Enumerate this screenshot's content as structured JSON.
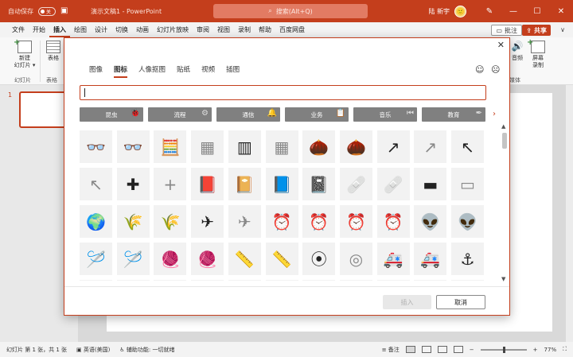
{
  "app": {
    "autosave_label": "自动保存",
    "autosave_state": "关",
    "doc_title": "演示文稿1 - PowerPoint",
    "search_placeholder": "搜索(Alt+Q)",
    "user_name": "陆 新宇",
    "user_avatar_text": "🙂"
  },
  "menu": {
    "items": [
      "文件",
      "开始",
      "插入",
      "绘图",
      "设计",
      "切换",
      "动画",
      "幻灯片放映",
      "审阅",
      "视图",
      "录制",
      "帮助",
      "百度网盘"
    ],
    "active_index": 2,
    "comment_label": "批注",
    "share_label": "共享"
  },
  "ribbon": {
    "new_slide_label": "新建\n幻灯片",
    "new_slide_line1": "新建",
    "new_slide_line2": "幻灯片 ▾",
    "table_label": "表格",
    "slides_group": "幻灯片",
    "tables_group": "表格",
    "audio_label": "音频",
    "screen_rec_line1": "屏幕",
    "screen_rec_line2": "录制",
    "media_group": "媒体"
  },
  "thumbnails": {
    "slide_number": "1"
  },
  "dialog": {
    "tabs": [
      "图像",
      "图标",
      "人像抠图",
      "贴纸",
      "视频",
      "插图"
    ],
    "active_tab_index": 1,
    "search_value": "",
    "categories": [
      {
        "label": "昆虫",
        "icon": "🐞"
      },
      {
        "label": "流程",
        "icon": "⚙"
      },
      {
        "label": "通信",
        "icon": "🔔"
      },
      {
        "label": "业务",
        "icon": "📋"
      },
      {
        "label": "音乐",
        "icon": "⏮"
      },
      {
        "label": "教育",
        "icon": "✒"
      }
    ],
    "icons": [
      {
        "name": "3d-glasses-filled-icon",
        "glyph": "👓",
        "light": false
      },
      {
        "name": "3d-glasses-outline-icon",
        "glyph": "👓",
        "light": true
      },
      {
        "name": "abacus-filled-icon",
        "glyph": "🧮",
        "light": false
      },
      {
        "name": "abacus-outline-icon",
        "glyph": "▦",
        "light": true
      },
      {
        "name": "abacus-frame-filled-icon",
        "glyph": "▥",
        "light": false
      },
      {
        "name": "abacus-frame-outline-icon",
        "glyph": "▦",
        "light": true
      },
      {
        "name": "acorn-filled-icon",
        "glyph": "🌰",
        "light": false
      },
      {
        "name": "acorn-outline-icon",
        "glyph": "🌰",
        "light": true
      },
      {
        "name": "arrow-curve-right-filled-icon",
        "glyph": "↗",
        "light": false
      },
      {
        "name": "arrow-curve-right-outline-icon",
        "glyph": "↗",
        "light": true
      },
      {
        "name": "arrow-curve-left-filled-icon",
        "glyph": "↖",
        "light": false
      },
      {
        "name": "arrow-curve-left-outline-icon",
        "glyph": "↖",
        "light": true
      },
      {
        "name": "plus-filled-icon",
        "glyph": "✚",
        "light": false
      },
      {
        "name": "plus-outline-icon",
        "glyph": "+",
        "light": true
      },
      {
        "name": "address-book-filled-icon",
        "glyph": "📕",
        "light": false
      },
      {
        "name": "address-book-outline-icon",
        "glyph": "📔",
        "light": true
      },
      {
        "name": "contact-book-filled-icon",
        "glyph": "📘",
        "light": false
      },
      {
        "name": "contact-book-outline-icon",
        "glyph": "📓",
        "light": true
      },
      {
        "name": "bandage-filled-icon",
        "glyph": "🩹",
        "light": false
      },
      {
        "name": "bandage-outline-icon",
        "glyph": "🩹",
        "light": true
      },
      {
        "name": "billboard-filled-icon",
        "glyph": "▬",
        "light": false
      },
      {
        "name": "billboard-outline-icon",
        "glyph": "▭",
        "light": true
      },
      {
        "name": "africa-map-icon",
        "glyph": "🌍",
        "light": false
      },
      {
        "name": "farmland-filled-icon",
        "glyph": "🌾",
        "light": false
      },
      {
        "name": "farmland-outline-icon",
        "glyph": "🌾",
        "light": true
      },
      {
        "name": "airplane-filled-icon",
        "glyph": "✈",
        "light": false
      },
      {
        "name": "airplane-outline-icon",
        "glyph": "✈",
        "light": true
      },
      {
        "name": "alarm-clock-filled-icon",
        "glyph": "⏰",
        "light": false
      },
      {
        "name": "alarm-clock-outline-icon",
        "glyph": "⏰",
        "light": true
      },
      {
        "name": "alarm-ringing-filled-icon",
        "glyph": "⏰",
        "light": false
      },
      {
        "name": "alarm-ringing-outline-icon",
        "glyph": "⏰",
        "light": true
      },
      {
        "name": "alien-filled-icon",
        "glyph": "👽",
        "light": false
      },
      {
        "name": "alien-outline-icon",
        "glyph": "👽",
        "light": true
      },
      {
        "name": "knitting-needle-filled-icon",
        "glyph": "🪡",
        "light": false
      },
      {
        "name": "knitting-needle-outline-icon",
        "glyph": "🪡",
        "light": true
      },
      {
        "name": "yarn-ball-filled-icon",
        "glyph": "🧶",
        "light": false
      },
      {
        "name": "yarn-ball-outline-icon",
        "glyph": "🧶",
        "light": true
      },
      {
        "name": "measuring-tape-filled-icon",
        "glyph": "📏",
        "light": false
      },
      {
        "name": "measuring-tape-outline-icon",
        "glyph": "📏",
        "light": true
      },
      {
        "name": "button-filled-icon",
        "glyph": "⦿",
        "light": false
      },
      {
        "name": "button-outline-icon",
        "glyph": "◎",
        "light": true
      },
      {
        "name": "ambulance-filled-icon",
        "glyph": "🚑",
        "light": false
      },
      {
        "name": "ambulance-outline-icon",
        "glyph": "🚑",
        "light": true
      },
      {
        "name": "anchor-icon",
        "glyph": "⚓",
        "light": false
      },
      {
        "name": "partial-icon-1",
        "glyph": "",
        "light": true
      },
      {
        "name": "partial-icon-2",
        "glyph": "",
        "light": true
      },
      {
        "name": "partial-icon-3",
        "glyph": "",
        "light": true
      },
      {
        "name": "partial-icon-4",
        "glyph": "",
        "light": true
      },
      {
        "name": "partial-icon-5",
        "glyph": "",
        "light": true
      },
      {
        "name": "partial-icon-6",
        "glyph": "",
        "light": true
      },
      {
        "name": "partial-icon-7",
        "glyph": "",
        "light": true
      },
      {
        "name": "partial-icon-8",
        "glyph": "",
        "light": true
      },
      {
        "name": "partial-icon-9",
        "glyph": "",
        "light": true
      },
      {
        "name": "partial-icon-10",
        "glyph": "",
        "light": true
      },
      {
        "name": "partial-icon-11",
        "glyph": "",
        "light": true
      }
    ],
    "insert_label": "插入",
    "cancel_label": "取消"
  },
  "status": {
    "slide_info": "幻灯片 第 1 张，共 1 张",
    "language": "英语(美国)",
    "accessibility": "辅助功能: 一切就绪",
    "notes_label": "备注",
    "zoom": "77%"
  },
  "colors": {
    "accent": "#c43e1c",
    "category_bg": "#808080",
    "cell_bg": "#f2f2f2"
  }
}
